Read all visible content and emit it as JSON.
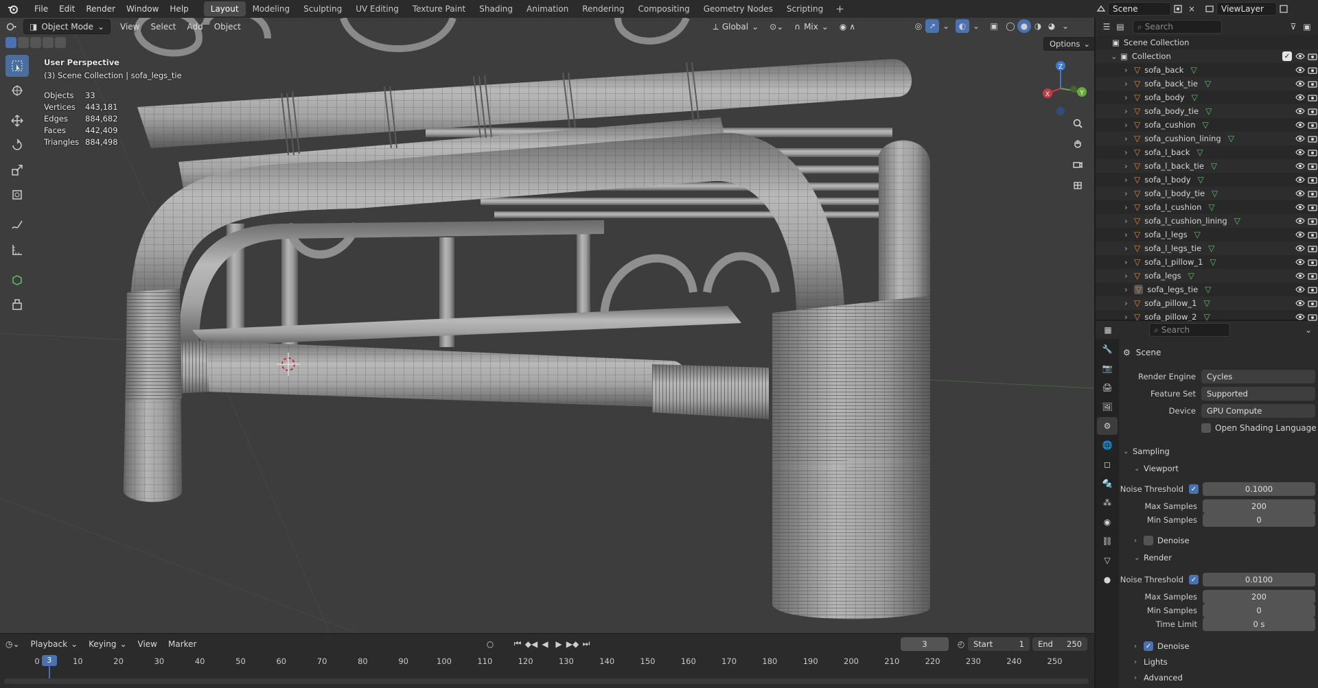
{
  "menus": [
    "File",
    "Edit",
    "Render",
    "Window",
    "Help"
  ],
  "workspaces": [
    {
      "label": "Layout",
      "active": true
    },
    {
      "label": "Modeling"
    },
    {
      "label": "Sculpting"
    },
    {
      "label": "UV Editing"
    },
    {
      "label": "Texture Paint"
    },
    {
      "label": "Shading"
    },
    {
      "label": "Animation"
    },
    {
      "label": "Rendering"
    },
    {
      "label": "Compositing"
    },
    {
      "label": "Geometry Nodes"
    },
    {
      "label": "Scripting"
    }
  ],
  "scene_name": "Scene",
  "view_layer": "ViewLayer",
  "viewport": {
    "mode": "Object Mode",
    "menus": [
      "View",
      "Select",
      "Add",
      "Object"
    ],
    "orientation": "Global",
    "snap": "Mix",
    "options_label": "Options",
    "perspective": "User Perspective",
    "active_path": "(3) Scene Collection | sofa_legs_tie",
    "stats": [
      {
        "k": "Objects",
        "v": "33"
      },
      {
        "k": "Vertices",
        "v": "443,181"
      },
      {
        "k": "Edges",
        "v": "884,682"
      },
      {
        "k": "Faces",
        "v": "442,409"
      },
      {
        "k": "Triangles",
        "v": "884,498"
      }
    ],
    "gizmo": {
      "x": "X",
      "y": "Y",
      "z": "Z"
    }
  },
  "timeline": {
    "menus": [
      "Playback",
      "Keying",
      "View",
      "Marker"
    ],
    "current_frame": "3",
    "start_label": "Start",
    "start": "1",
    "end_label": "End",
    "end": "250",
    "ticks": [
      "0",
      "10",
      "20",
      "30",
      "40",
      "50",
      "60",
      "70",
      "80",
      "90",
      "100",
      "110",
      "120",
      "130",
      "140",
      "150",
      "160",
      "170",
      "180",
      "190",
      "200",
      "210",
      "220",
      "230",
      "240",
      "250"
    ]
  },
  "outliner": {
    "search_placeholder": "Search",
    "root": "Scene Collection",
    "collection": "Collection",
    "items": [
      "sofa_back",
      "sofa_back_tie",
      "sofa_body",
      "sofa_body_tie",
      "sofa_cushion",
      "sofa_cushion_lining",
      "sofa_l_back",
      "sofa_l_back_tie",
      "sofa_l_body",
      "sofa_l_body_tie",
      "sofa_l_cushion",
      "sofa_l_cushion_lining",
      "sofa_l_legs",
      "sofa_l_legs_tie",
      "sofa_l_pillow_1",
      "sofa_legs",
      "sofa_legs_tie",
      "sofa_pillow_1",
      "sofa_pillow_2"
    ],
    "active": "sofa_legs_tie"
  },
  "properties": {
    "search_placeholder": "Search",
    "context": "Scene",
    "render_engine_label": "Render Engine",
    "render_engine": "Cycles",
    "feature_set_label": "Feature Set",
    "feature_set": "Supported",
    "device_label": "Device",
    "device": "GPU Compute",
    "osl_label": "Open Shading Language",
    "sampling": "Sampling",
    "viewport_label": "Viewport",
    "noise_threshold_label": "Noise Threshold",
    "vp_noise": "0.1000",
    "max_samples_label": "Max Samples",
    "vp_max": "200",
    "min_samples_label": "Min Samples",
    "vp_min": "0",
    "denoise_label": "Denoise",
    "render_label": "Render",
    "r_noise": "0.0100",
    "r_max": "200",
    "r_min": "0",
    "time_limit_label": "Time Limit",
    "time_limit": "0 s",
    "lights_label": "Lights",
    "advanced_label": "Advanced"
  },
  "colors": {
    "accent": "#4a72b0",
    "object": "#e38a32",
    "mesh": "#5cc66a"
  }
}
